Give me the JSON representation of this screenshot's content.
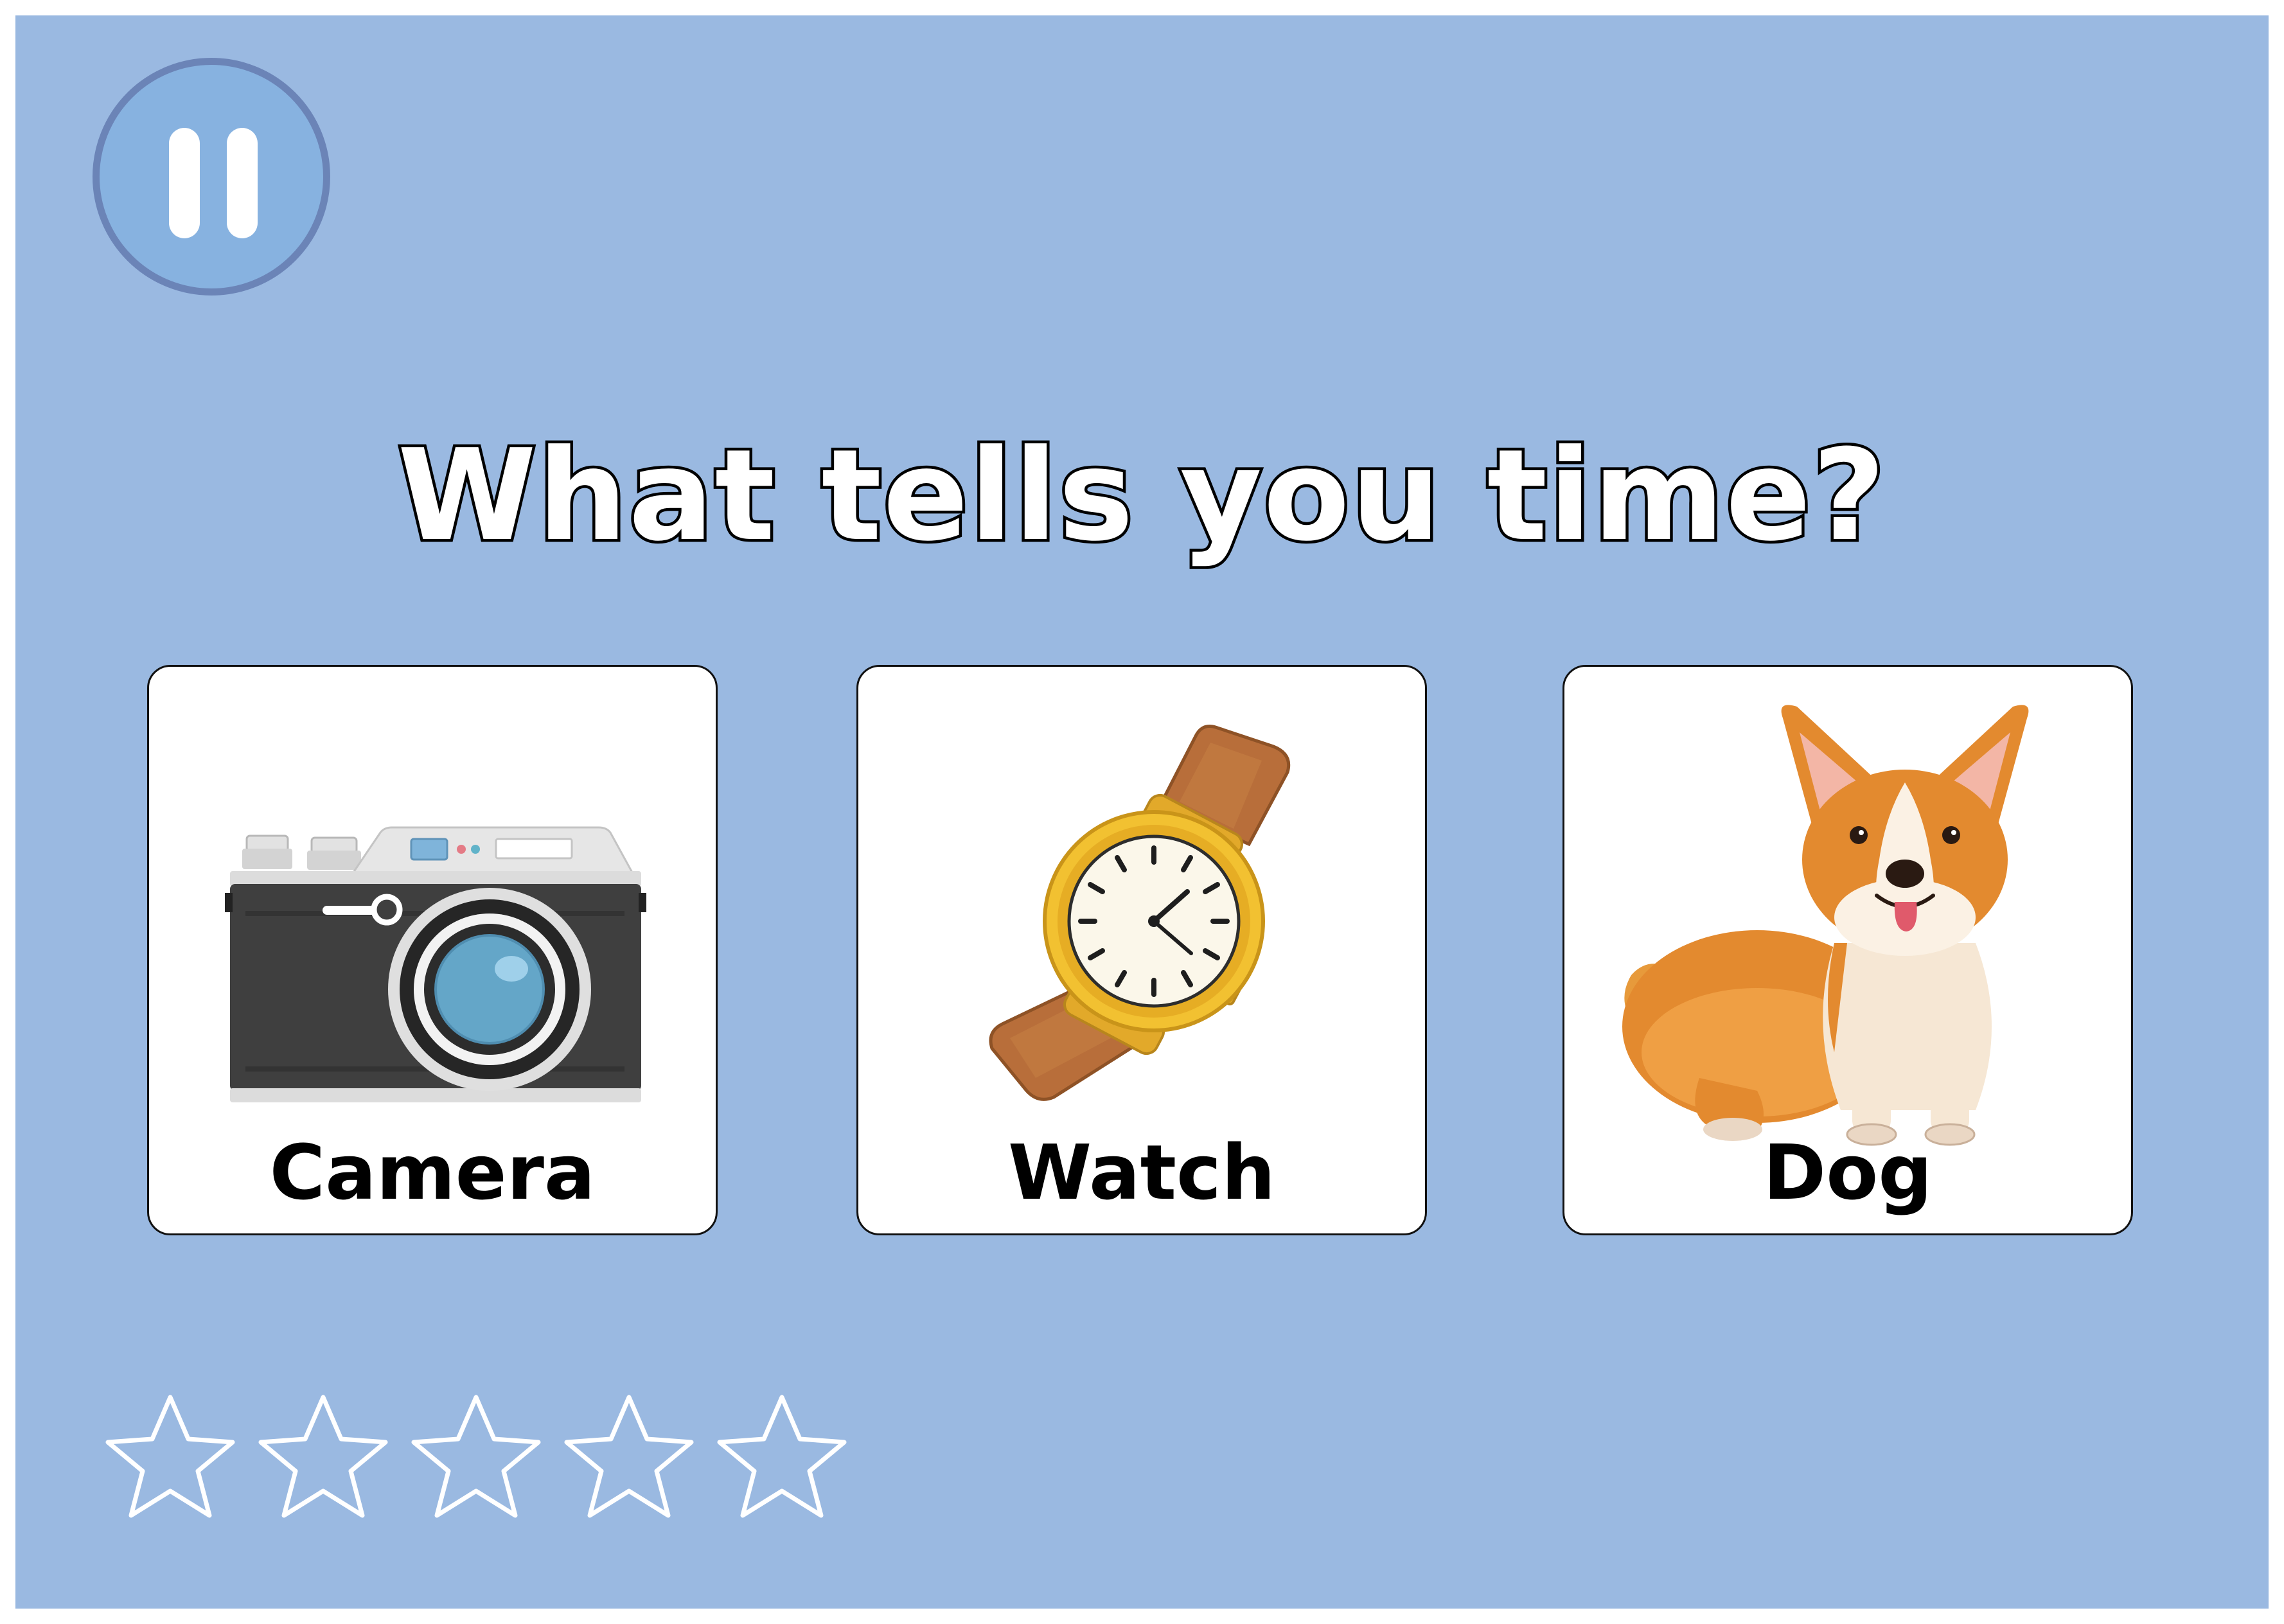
{
  "game": {
    "question": "What  tells you time?",
    "colors": {
      "background": "#9ab9e1",
      "pause_fill": "#87b2e0",
      "pause_ring": "#6b84b7"
    },
    "pause_icon": "pause-icon"
  },
  "options": [
    {
      "label": "Camera",
      "icon": "camera-icon"
    },
    {
      "label": "Watch",
      "icon": "watch-icon"
    },
    {
      "label": "Dog",
      "icon": "dog-icon"
    }
  ],
  "stars": {
    "earned": 0,
    "total": 5,
    "icon": "star-outline-icon"
  }
}
